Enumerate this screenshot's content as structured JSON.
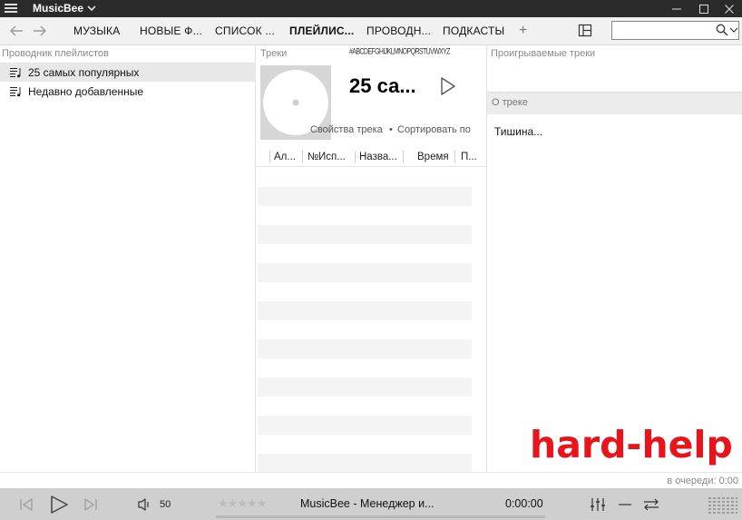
{
  "app": {
    "title": "MusicBee"
  },
  "nav": {
    "tabs": [
      {
        "label": "МУЗЫКА",
        "active": false
      },
      {
        "label": "НОВЫЕ Ф...",
        "active": false
      },
      {
        "label": "СПИСОК ...",
        "active": false
      },
      {
        "label": "ПЛЕЙЛИС...",
        "active": true
      },
      {
        "label": "ПРОВОДН...",
        "active": false
      },
      {
        "label": "ПОДКАСТЫ",
        "active": false
      }
    ],
    "add_tab": "+",
    "search": {
      "value": "",
      "placeholder": ""
    }
  },
  "playlist_explorer": {
    "header": "Проводник плейлистов",
    "items": [
      {
        "label": "25 самых популярных",
        "selected": true
      },
      {
        "label": "Недавно добавленные",
        "selected": false
      }
    ]
  },
  "tracks": {
    "header": "Треки",
    "alpha_index": "#ABCDEFGHIJKLMNOPQRSTUVWXYZ",
    "playlist_title": "25 са...",
    "links": [
      "Свойства трека",
      "Сортировать по"
    ],
    "link_sep": "•",
    "columns": [
      "Ал...",
      "№",
      "Исп...",
      "Назва...",
      "Время",
      "П..."
    ]
  },
  "now_playing": {
    "header": "Проигрываемые треки",
    "about_header": "О треке",
    "about_text": "Тишина..."
  },
  "status": {
    "queue": "в очереди: 0:00"
  },
  "player": {
    "volume": "50",
    "rating_stars": "★★★★★",
    "track_title": "MusicBee - Менеджер и...",
    "time": "0:00:00"
  },
  "watermark": "hard-help",
  "colors": {
    "accent_red": "#e8141c",
    "titlebar": "#2b2b2b",
    "player_bg": "#cfcfcf"
  }
}
